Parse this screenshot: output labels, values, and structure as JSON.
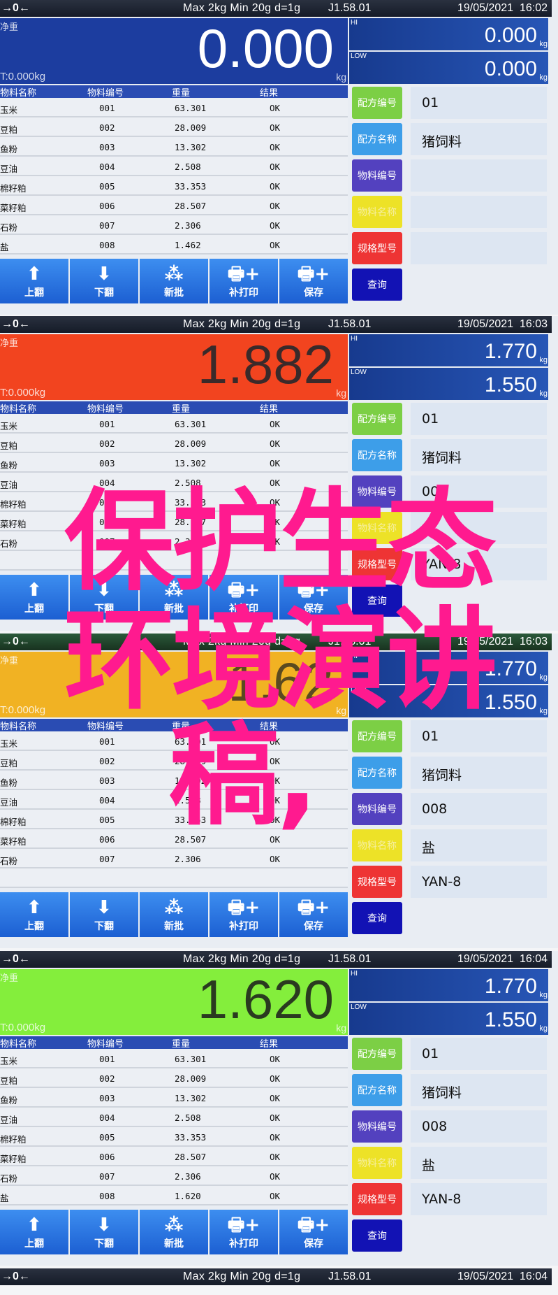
{
  "header": {
    "zero_icon": "→0←",
    "spec": "Max 2kg  Min 20g  d=1g",
    "firmware": "J1.58.01",
    "date": "19/05/2021"
  },
  "main": {
    "label": "净重",
    "tare": "T:0.000kg",
    "unit": "kg"
  },
  "limits": {
    "hi_label": "HI",
    "low_label": "LOW",
    "unit": "kg"
  },
  "table": {
    "headers": [
      "物料名称",
      "物料编号",
      "重量",
      "结果"
    ]
  },
  "buttons": [
    {
      "label": "上翻",
      "icon": "arrow-up"
    },
    {
      "label": "下翻",
      "icon": "arrow-down"
    },
    {
      "label": "新批",
      "icon": "stack"
    },
    {
      "label": "补打印",
      "icon": "printer-plus"
    },
    {
      "label": "保存",
      "icon": "printer-plus"
    }
  ],
  "side_buttons": [
    {
      "label": "配方编号",
      "color": "#7ccf45"
    },
    {
      "label": "配方名称",
      "color": "#3d9ee9"
    },
    {
      "label": "物料编号",
      "color": "#5341bf"
    },
    {
      "label": "物料名称",
      "color": "#ede227"
    },
    {
      "label": "规格型号",
      "color": "#ee3434"
    },
    {
      "label": "查询",
      "color": "#1212b4"
    }
  ],
  "panels": [
    {
      "time": "16:02",
      "weight": "0.000",
      "main_color": "#1c3d9f",
      "weight_color": "#ffffff",
      "hi": "0.000",
      "low": "0.000",
      "rows": [
        [
          "玉米",
          "001",
          "63.301",
          "OK"
        ],
        [
          "豆粕",
          "002",
          "28.009",
          "OK"
        ],
        [
          "鱼粉",
          "003",
          "13.302",
          "OK"
        ],
        [
          "豆油",
          "004",
          "2.508",
          "OK"
        ],
        [
          "棉籽粕",
          "005",
          "33.353",
          "OK"
        ],
        [
          "菜籽粕",
          "006",
          "28.507",
          "OK"
        ],
        [
          "石粉",
          "007",
          "2.306",
          "OK"
        ],
        [
          "盐",
          "008",
          "1.462",
          "OK"
        ]
      ],
      "side_values": [
        "01",
        "猪饲料",
        "",
        "",
        "",
        ""
      ]
    },
    {
      "time": "16:03",
      "weight": "1.882",
      "main_color": "#f2441f",
      "weight_color": "#3a2a2a",
      "hi": "1.770",
      "low": "1.550",
      "rows": [
        [
          "玉米",
          "001",
          "63.301",
          "OK"
        ],
        [
          "豆粕",
          "002",
          "28.009",
          "OK"
        ],
        [
          "鱼粉",
          "003",
          "13.302",
          "OK"
        ],
        [
          "豆油",
          "004",
          "2.508",
          "OK"
        ],
        [
          "棉籽粕",
          "005",
          "33.353",
          "OK"
        ],
        [
          "菜籽粕",
          "006",
          "28.507",
          "OK"
        ],
        [
          "石粉",
          "007",
          "2.306",
          "OK"
        ],
        [
          "",
          "",
          "",
          ""
        ]
      ],
      "side_values": [
        "01",
        "猪饲料",
        "008",
        "盐",
        "YAN-8",
        ""
      ]
    },
    {
      "time": "16:03",
      "weight": "1.62",
      "main_color": "#f1b223",
      "weight_color": "#5a4a20",
      "hi": "1.770",
      "low": "1.550",
      "rows": [
        [
          "玉米",
          "001",
          "63.301",
          "OK"
        ],
        [
          "豆粕",
          "002",
          "28.009",
          "OK"
        ],
        [
          "鱼粉",
          "003",
          "13.302",
          "OK"
        ],
        [
          "豆油",
          "004",
          "2.508",
          "OK"
        ],
        [
          "棉籽粕",
          "005",
          "33.353",
          "OK"
        ],
        [
          "菜籽粕",
          "006",
          "28.507",
          "OK"
        ],
        [
          "石粉",
          "007",
          "2.306",
          "OK"
        ],
        [
          "",
          "",
          "",
          ""
        ]
      ],
      "side_values": [
        "01",
        "猪饲料",
        "008",
        "盐",
        "YAN-8",
        ""
      ]
    },
    {
      "time": "16:04",
      "weight": "1.620",
      "main_color": "#84ee3c",
      "weight_color": "#2a3a20",
      "hi": "1.770",
      "low": "1.550",
      "rows": [
        [
          "玉米",
          "001",
          "63.301",
          "OK"
        ],
        [
          "豆粕",
          "002",
          "28.009",
          "OK"
        ],
        [
          "鱼粉",
          "003",
          "13.302",
          "OK"
        ],
        [
          "豆油",
          "004",
          "2.508",
          "OK"
        ],
        [
          "棉籽粕",
          "005",
          "33.353",
          "OK"
        ],
        [
          "菜籽粕",
          "006",
          "28.507",
          "OK"
        ],
        [
          "石粉",
          "007",
          "2.306",
          "OK"
        ],
        [
          "盐",
          "008",
          "1.620",
          "OK"
        ]
      ],
      "side_values": [
        "01",
        "猪饲料",
        "008",
        "盐",
        "YAN-8",
        ""
      ]
    }
  ],
  "last_header_time": "16:04",
  "overlay": {
    "line1": "保护生态",
    "line2": "环境演讲",
    "line3": "稿,",
    "color": "#ff1a8f"
  }
}
